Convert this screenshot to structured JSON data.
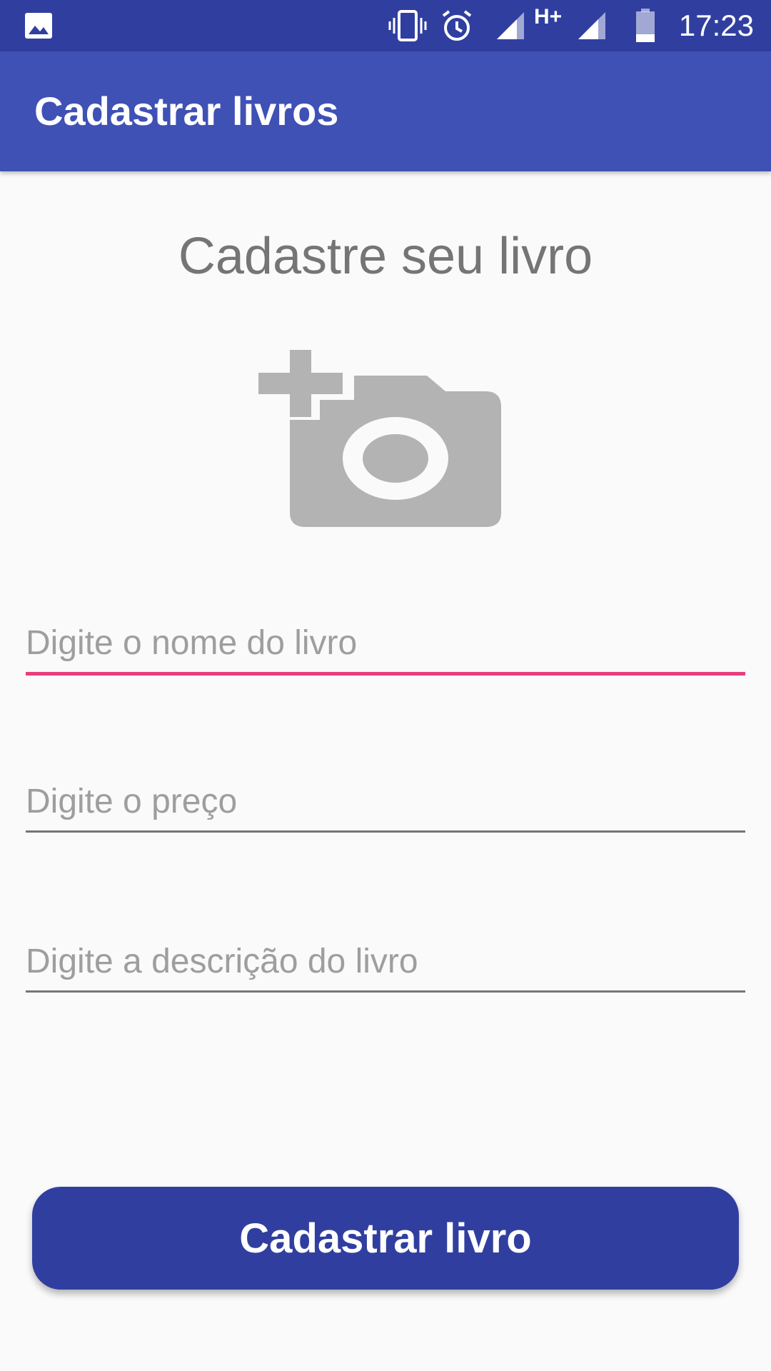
{
  "status_bar": {
    "time": "17:23",
    "icons": [
      "image-icon",
      "vibrate-icon",
      "alarm-icon",
      "signal-icon",
      "hplus-icon",
      "signal-icon",
      "battery-icon"
    ],
    "network_label": "H+"
  },
  "app_bar": {
    "title": "Cadastrar livros"
  },
  "main": {
    "heading": "Cadastre seu livro",
    "photo_icon": "add-a-photo-icon",
    "fields": [
      {
        "placeholder": "Digite o nome do livro",
        "value": "",
        "focused": true
      },
      {
        "placeholder": "Digite o preço",
        "value": ""
      },
      {
        "placeholder": "Digite a descrição do livro",
        "value": ""
      }
    ],
    "submit_label": "Cadastrar livro"
  },
  "colors": {
    "status_bar": "#303f9f",
    "app_bar": "#3f51b5",
    "accent": "#e83e7d",
    "button": "#303f9f",
    "icon_gray": "#b3b3b3"
  }
}
